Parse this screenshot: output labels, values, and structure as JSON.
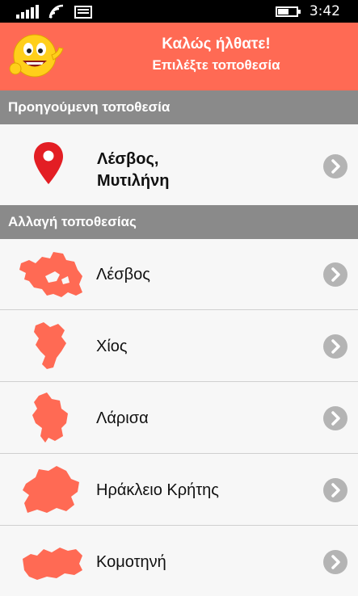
{
  "status_bar": {
    "time": "3:42",
    "icons": [
      "signal-icon",
      "wifi-icon",
      "message-icon",
      "battery-icon"
    ],
    "battery_level": 0.55
  },
  "header": {
    "title": "Καλώς ήλθατε!",
    "subtitle": "Επιλέξτε τοποθεσία",
    "background_color": "#ff6a54",
    "icon": "smiley-icon"
  },
  "previous_section": {
    "title": "Προηγούμενη τοποθεσία",
    "item": {
      "line1": "Λέσβος,",
      "line2": "Μυτιλήνη",
      "icon": "location-pin-icon"
    }
  },
  "change_section": {
    "title": "Αλλαγή τοποθεσίας",
    "items": [
      {
        "label": "Λέσβος",
        "icon": "lesvos-map-icon"
      },
      {
        "label": "Χίος",
        "icon": "chios-map-icon"
      },
      {
        "label": "Λάρισα",
        "icon": "larisa-map-icon"
      },
      {
        "label": "Ηράκλειο Κρήτης",
        "icon": "heraklion-map-icon"
      },
      {
        "label": "Κομοτηνή",
        "icon": "komotini-map-icon"
      }
    ]
  },
  "colors": {
    "accent": "#ff6a54",
    "section_header": "#8a8a8a",
    "chevron": "#b4b4b4",
    "pin": "#e31e24"
  }
}
